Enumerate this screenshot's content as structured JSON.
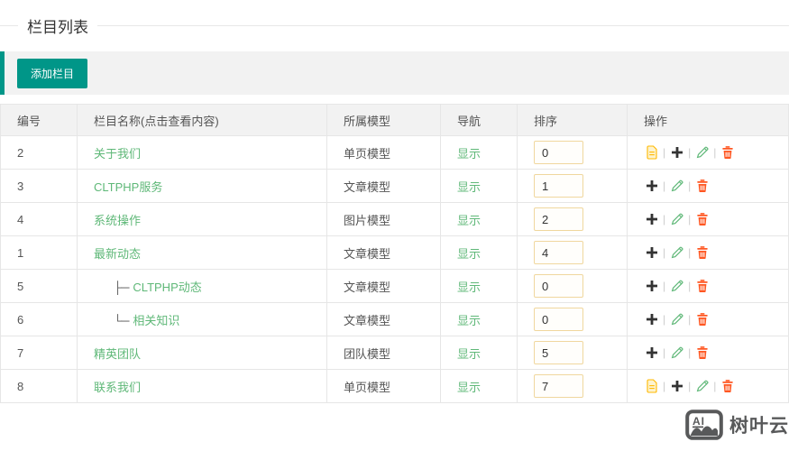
{
  "title": "栏目列表",
  "toolbar": {
    "add_button_label": "添加栏目"
  },
  "table": {
    "headers": [
      "编号",
      "栏目名称(点击查看内容)",
      "所属模型",
      "导航",
      "排序",
      "操作"
    ],
    "rows": [
      {
        "id": "2",
        "tree_prefix": "",
        "name": "关于我们",
        "model": "单页模型",
        "nav": "显示",
        "sort": "0",
        "ops": [
          "view-content",
          "add-child",
          "edit",
          "delete"
        ]
      },
      {
        "id": "3",
        "tree_prefix": "",
        "name": "CLTPHP服务",
        "model": "文章模型",
        "nav": "显示",
        "sort": "1",
        "ops": [
          "add-child",
          "edit",
          "delete"
        ]
      },
      {
        "id": "4",
        "tree_prefix": "",
        "name": "系统操作",
        "model": "图片模型",
        "nav": "显示",
        "sort": "2",
        "ops": [
          "add-child",
          "edit",
          "delete"
        ]
      },
      {
        "id": "1",
        "tree_prefix": "",
        "name": "最新动态",
        "model": "文章模型",
        "nav": "显示",
        "sort": "4",
        "ops": [
          "add-child",
          "edit",
          "delete"
        ]
      },
      {
        "id": "5",
        "tree_prefix": "├─",
        "name": "CLTPHP动态",
        "model": "文章模型",
        "nav": "显示",
        "sort": "0",
        "ops": [
          "add-child",
          "edit",
          "delete"
        ]
      },
      {
        "id": "6",
        "tree_prefix": "└─",
        "name": "相关知识",
        "model": "文章模型",
        "nav": "显示",
        "sort": "0",
        "ops": [
          "add-child",
          "edit",
          "delete"
        ]
      },
      {
        "id": "7",
        "tree_prefix": "",
        "name": "精英团队",
        "model": "团队模型",
        "nav": "显示",
        "sort": "5",
        "ops": [
          "add-child",
          "edit",
          "delete"
        ]
      },
      {
        "id": "8",
        "tree_prefix": "",
        "name": "联系我们",
        "model": "单页模型",
        "nav": "显示",
        "sort": "7",
        "ops": [
          "view-content",
          "add-child",
          "edit",
          "delete"
        ]
      }
    ]
  },
  "watermark": {
    "logo_text": "AI",
    "brand": "树叶云"
  },
  "colors": {
    "accent": "#009688",
    "link_green": "#5FB878",
    "doc_yellow": "#FFB800",
    "danger_orange": "#FF5722"
  }
}
